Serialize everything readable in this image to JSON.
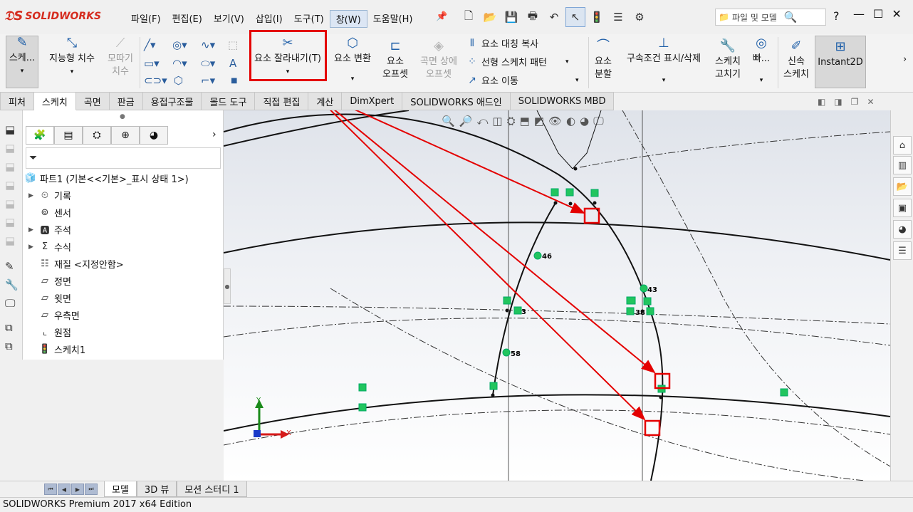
{
  "app": {
    "logo": "SOLIDWORKS"
  },
  "menu": [
    "파일(F)",
    "편집(E)",
    "보기(V)",
    "삽입(I)",
    "도구(T)",
    "창(W)",
    "도움말(H)"
  ],
  "search": {
    "placeholder": "파일 및 모델"
  },
  "ribbon": {
    "sketch": "스케...",
    "smart_dim": "지능형 치수",
    "chamfer_1": "모따기",
    "chamfer_2": "치수",
    "trim": "요소 잘라내기(T)",
    "convert": "요소 변환",
    "offset_1": "요소",
    "offset_2": "오프셋",
    "surf_offset_1": "곡면 상에",
    "surf_offset_2": "오프셋",
    "mirror": "요소 대칭 복사",
    "linear_pattern": "선형 스케치 패턴",
    "move": "요소 이동",
    "split_1": "요소",
    "split_2": "분할",
    "relations": "구속조건 표시/삭제",
    "repair_1": "스케치",
    "repair_2": "고치기",
    "quick_snaps": "빠...",
    "rapid_1": "신속",
    "rapid_2": "스케치",
    "instant2d": "Instant2D"
  },
  "cm_tabs": [
    "피처",
    "스케치",
    "곡면",
    "판금",
    "용접구조물",
    "몰드 도구",
    "직접 편집",
    "계산",
    "DimXpert",
    "SOLIDWORKS 애드인",
    "SOLIDWORKS MBD"
  ],
  "tree": {
    "root": "파트1  (기본<<기본>_표시 상태 1>)",
    "items": [
      "기록",
      "센서",
      "주석",
      "수식",
      "재질 <지정안함>",
      "정면",
      "윗면",
      "우측면",
      "원점",
      "스케치1"
    ]
  },
  "dims": [
    "46",
    "43",
    "3",
    "38",
    "58"
  ],
  "axes": {
    "x": "X",
    "y": "Y"
  },
  "bottom_tabs": [
    "모델",
    "3D 뷰",
    "모션 스터디 1"
  ],
  "status": "SOLIDWORKS Premium 2017 x64 Edition",
  "colors": {
    "accent_red": "#e40000",
    "relation_green": "#22c55e",
    "brand": "#d52b1e"
  }
}
